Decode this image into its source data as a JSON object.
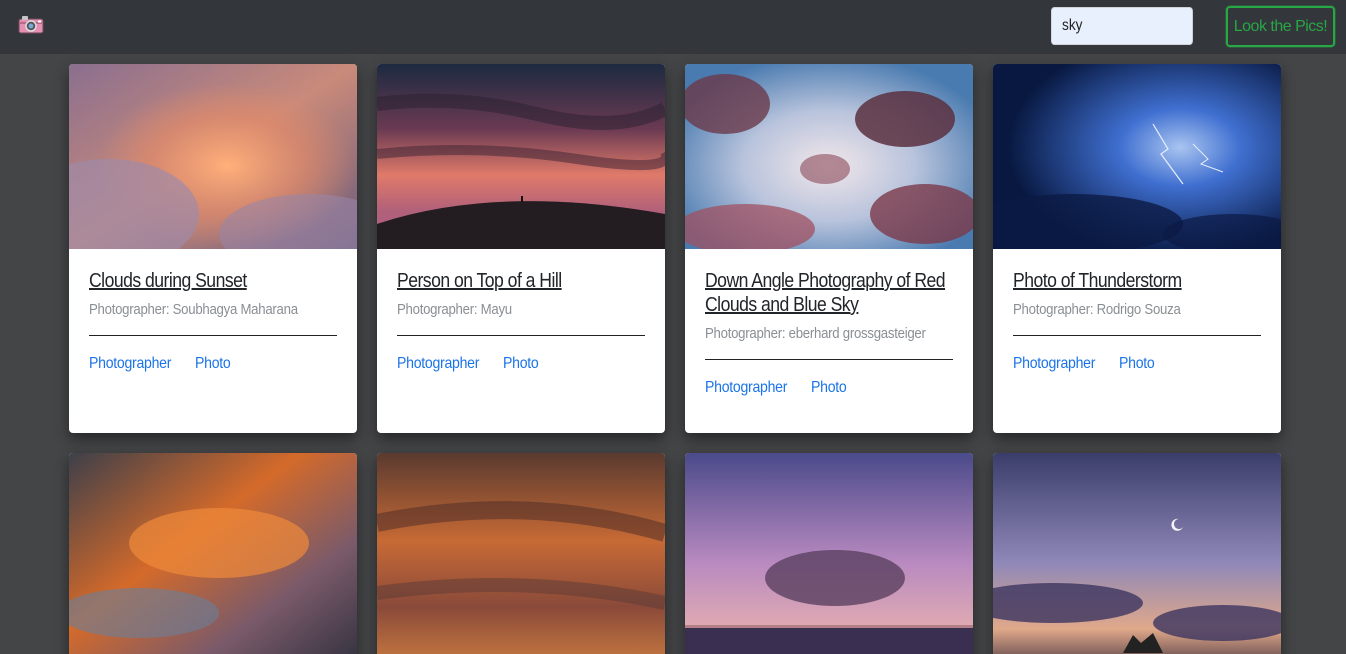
{
  "navbar": {
    "brand_icon": "camera-icon",
    "search": {
      "value": "sky",
      "placeholder": ""
    },
    "search_button_label": "Look the Pics!",
    "accent": "#28a745"
  },
  "cards": [
    {
      "title": "Clouds during Sunset",
      "photographer": "Photographer: Soubhagya Maharana",
      "link_photographer": "Photographer",
      "link_photo": "Photo"
    },
    {
      "title": "Person on Top of a Hill",
      "photographer": "Photographer: Mayu",
      "link_photographer": "Photographer",
      "link_photo": "Photo"
    },
    {
      "title": "Down Angle Photography of Red Clouds and Blue Sky",
      "photographer": "Photographer: eberhard grossgasteiger",
      "link_photographer": "Photographer",
      "link_photo": "Photo"
    },
    {
      "title": "Photo of Thunderstorm",
      "photographer": "Photographer: Rodrigo Souza",
      "link_photographer": "Photographer",
      "link_photo": "Photo"
    }
  ],
  "link_color": "#1a73e8"
}
